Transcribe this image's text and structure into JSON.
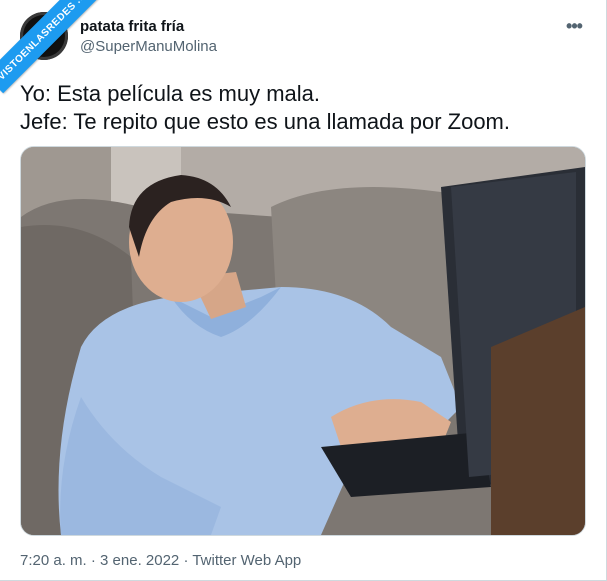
{
  "tweet": {
    "display_name": "patata frita fría",
    "handle": "@SuperManuMolina",
    "text_lines": [
      "Yo: Esta película es muy mala.",
      "Jefe: Te repito que esto es una llamada por Zoom."
    ],
    "timestamp": "7:20 a. m. · 3 ene. 2022 · Twitter Web App",
    "more_icon": "more-horizontal-icon"
  },
  "watermark": {
    "text": "VISTOENLASREDES .com"
  },
  "colors": {
    "accent": "#1d9bf0",
    "secondary_text": "#536471",
    "primary_text": "#0f1419"
  }
}
